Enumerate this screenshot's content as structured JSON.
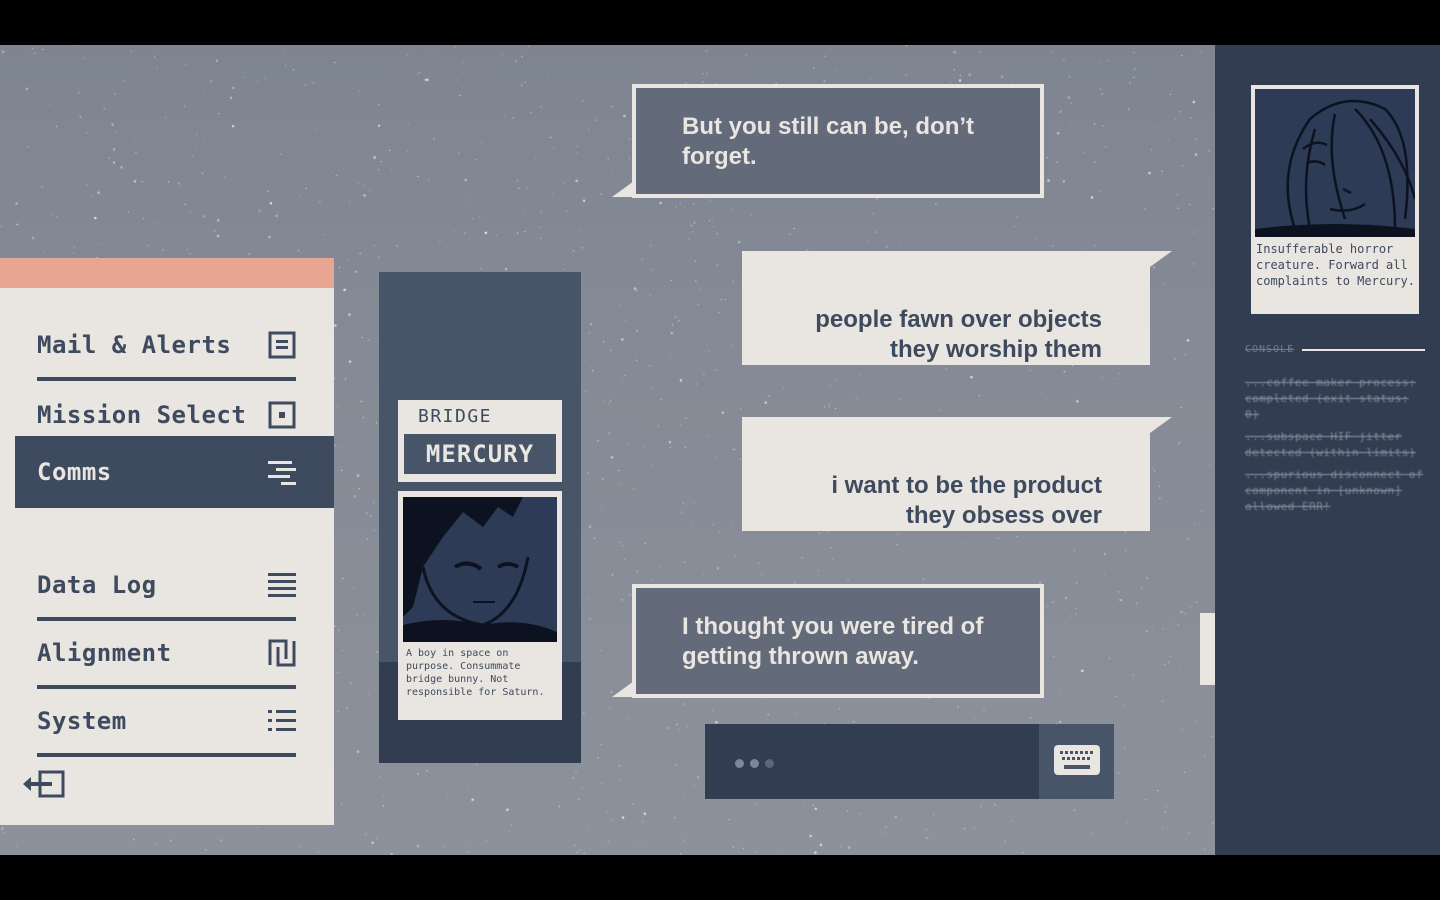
{
  "colors": {
    "cream": "#e9e5e0",
    "navy": "#3e4a5e",
    "panel_dark": "#333d51",
    "panel_mid": "#485467",
    "accent_salmon": "#e8a591",
    "bubble_gray": "#636b7a"
  },
  "menu": {
    "items": [
      {
        "label": "Mail & Alerts",
        "icon": "mail-icon",
        "active": false
      },
      {
        "label": "Mission Select",
        "icon": "target-square-icon",
        "active": false
      },
      {
        "label": "Comms",
        "icon": "comms-lines-icon",
        "active": true
      },
      {
        "label": "Data Log",
        "icon": "data-log-icon",
        "active": false
      },
      {
        "label": "Alignment",
        "icon": "alignment-icon",
        "active": false
      },
      {
        "label": "System",
        "icon": "list-icon",
        "active": false
      }
    ],
    "logout_icon": "logout-icon"
  },
  "contact": {
    "role": "BRIDGE",
    "name": "MERCURY",
    "description": "A boy in space on purpose. Consummate bridge bunny. Not responsible for Saturn."
  },
  "chat": {
    "messages": [
      {
        "sender": "them",
        "text": "But you still can be, don’t forget."
      },
      {
        "sender": "me",
        "text": "people fawn over objects\nthey worship them"
      },
      {
        "sender": "me",
        "text": "i want to be the product\nthey obsess over"
      },
      {
        "sender": "them",
        "text": "I thought you were tired of getting thrown away."
      }
    ],
    "typing_indicator": "•••",
    "keyboard_icon": "keyboard-icon"
  },
  "profile": {
    "description": "Insufferable horror creature. Forward all complaints to Mercury."
  },
  "console": {
    "label": "CONSOLE",
    "lines": [
      "...coffee maker process: completed (exit status: 0)",
      "...subspace HIF jitter detected (within limits)",
      "...spurious disconnect of component in [unknown] allowed ERR!"
    ]
  }
}
